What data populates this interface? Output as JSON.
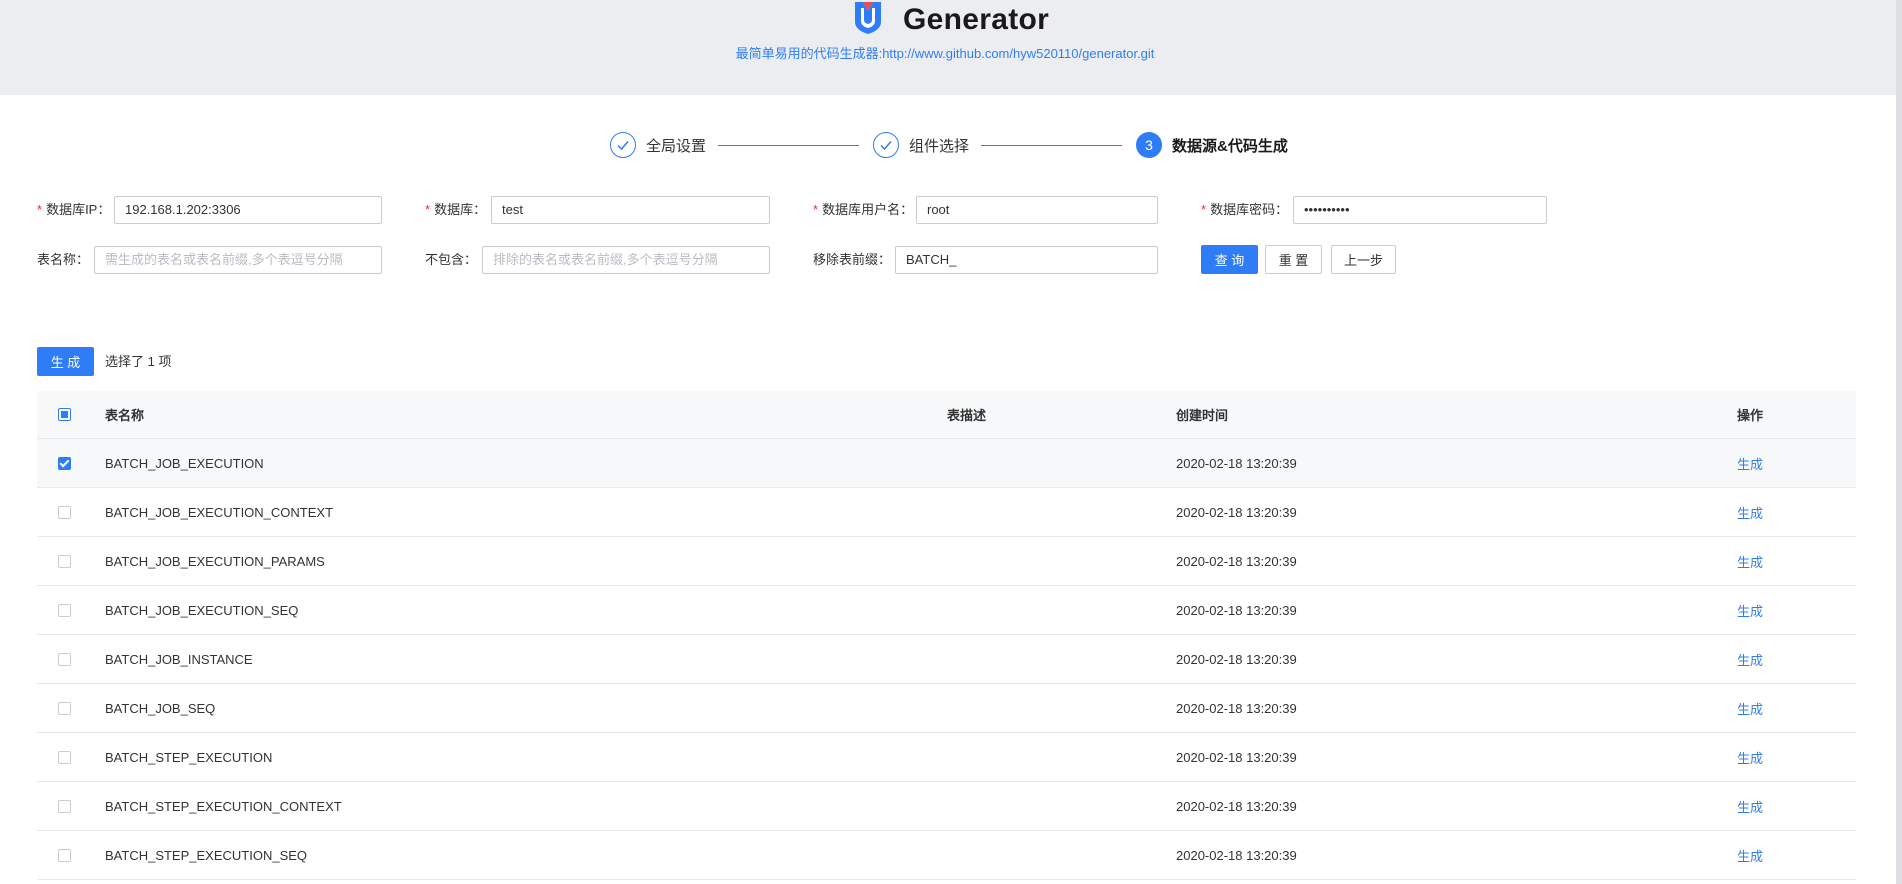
{
  "header": {
    "title": "Generator",
    "subtitle": "最简单易用的代码生成器:http://www.github.com/hyw520110/generator.git"
  },
  "steps": [
    {
      "index": "1",
      "label": "全局设置",
      "status": "done"
    },
    {
      "index": "2",
      "label": "组件选择",
      "status": "done"
    },
    {
      "index": "3",
      "label": "数据源&代码生成",
      "status": "active"
    }
  ],
  "form": {
    "db_ip": {
      "label": "数据库IP",
      "value": "192.168.1.202:3306"
    },
    "db_name": {
      "label": "数据库",
      "value": "test"
    },
    "db_user": {
      "label": "数据库用户名",
      "value": "root"
    },
    "db_password": {
      "label": "数据库密码",
      "value": "••••••••••"
    },
    "table_name": {
      "label": "表名称",
      "placeholder": "需生成的表名或表名前缀,多个表逗号分隔"
    },
    "exclude": {
      "label": "不包含",
      "placeholder": "排除的表名或表名前缀,多个表逗号分隔"
    },
    "remove_prefix": {
      "label": "移除表前缀",
      "value": "BATCH_"
    },
    "buttons": {
      "query": "查 询",
      "reset": "重 置",
      "prev": "上一步"
    }
  },
  "toolbar": {
    "generate": "生 成",
    "selected_info": "选择了 1 项"
  },
  "table": {
    "columns": {
      "name": "表名称",
      "description": "表描述",
      "created": "创建时间",
      "action": "操作"
    },
    "rows": [
      {
        "name": "BATCH_JOB_EXECUTION",
        "description": "",
        "created": "2020-02-18 13:20:39",
        "action": "生成",
        "checked": true
      },
      {
        "name": "BATCH_JOB_EXECUTION_CONTEXT",
        "description": "",
        "created": "2020-02-18 13:20:39",
        "action": "生成",
        "checked": false
      },
      {
        "name": "BATCH_JOB_EXECUTION_PARAMS",
        "description": "",
        "created": "2020-02-18 13:20:39",
        "action": "生成",
        "checked": false
      },
      {
        "name": "BATCH_JOB_EXECUTION_SEQ",
        "description": "",
        "created": "2020-02-18 13:20:39",
        "action": "生成",
        "checked": false
      },
      {
        "name": "BATCH_JOB_INSTANCE",
        "description": "",
        "created": "2020-02-18 13:20:39",
        "action": "生成",
        "checked": false
      },
      {
        "name": "BATCH_JOB_SEQ",
        "description": "",
        "created": "2020-02-18 13:20:39",
        "action": "生成",
        "checked": false
      },
      {
        "name": "BATCH_STEP_EXECUTION",
        "description": "",
        "created": "2020-02-18 13:20:39",
        "action": "生成",
        "checked": false
      },
      {
        "name": "BATCH_STEP_EXECUTION_CONTEXT",
        "description": "",
        "created": "2020-02-18 13:20:39",
        "action": "生成",
        "checked": false
      },
      {
        "name": "BATCH_STEP_EXECUTION_SEQ",
        "description": "",
        "created": "2020-02-18 13:20:39",
        "action": "生成",
        "checked": false
      }
    ]
  },
  "colors": {
    "primary": "#2f7df6",
    "header_bg": "#ecedf1",
    "required": "#f5222d"
  }
}
